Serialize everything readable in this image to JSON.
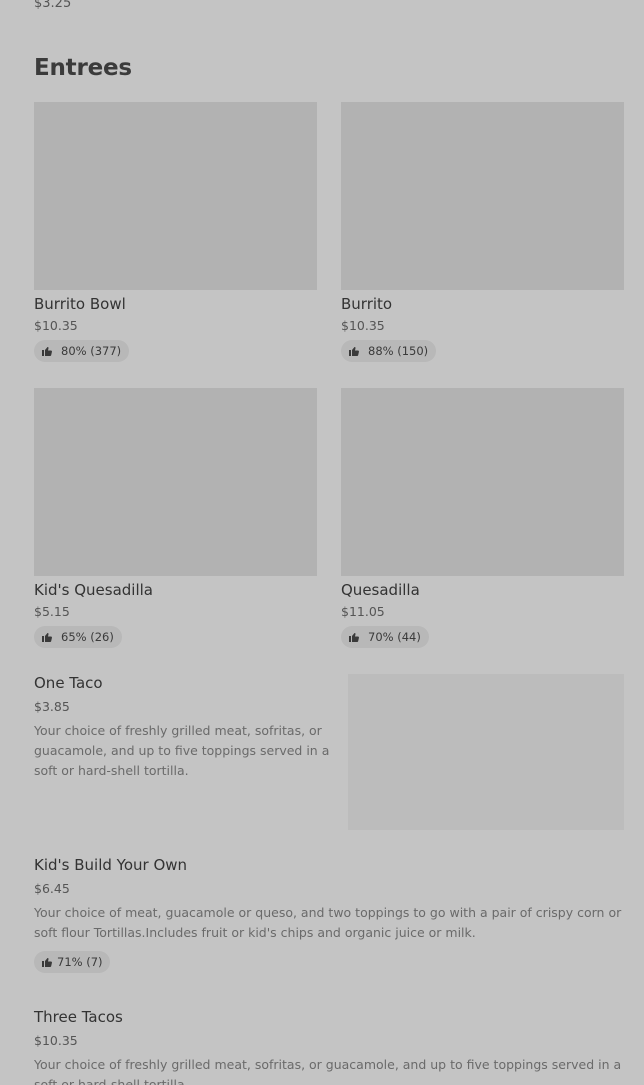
{
  "top_price": "$3.25",
  "section": {
    "title": "Entrees"
  },
  "cards": [
    {
      "name": "Burrito Bowl",
      "price": "$10.35",
      "rating": "80% (377)"
    },
    {
      "name": "Burrito",
      "price": "$10.35",
      "rating": "88% (150)"
    },
    {
      "name": "Kid's Quesadilla",
      "price": "$5.15",
      "rating": "65% (26)"
    },
    {
      "name": "Quesadilla",
      "price": "$11.05",
      "rating": "70% (44)"
    }
  ],
  "rows": [
    {
      "name": "One Taco",
      "price": "$3.85",
      "description": "Your choice of freshly grilled meat, sofritas, or guacamole, and up to five toppings served in a soft or hard-shell tortilla."
    },
    {
      "name": "Kid's Build Your Own",
      "price": "$6.45",
      "description": "Your choice of meat, guacamole or queso, and two toppings to go with a pair of crispy corn or soft flour Tortillas.Includes fruit or kid's chips and organic juice or milk.",
      "rating": "71% (7)"
    },
    {
      "name": "Three Tacos",
      "price": "$10.35",
      "description": "Your choice of freshly grilled meat, sofritas, or guacamole, and up to five toppings served in a soft or hard-shell tortilla."
    }
  ],
  "icons": {
    "rating": "thumbs-up-icon"
  },
  "colors": {
    "background": "#c4c4c4",
    "image_placeholder": "#b2b2b2",
    "rating_pill": "#b8b8b8"
  }
}
